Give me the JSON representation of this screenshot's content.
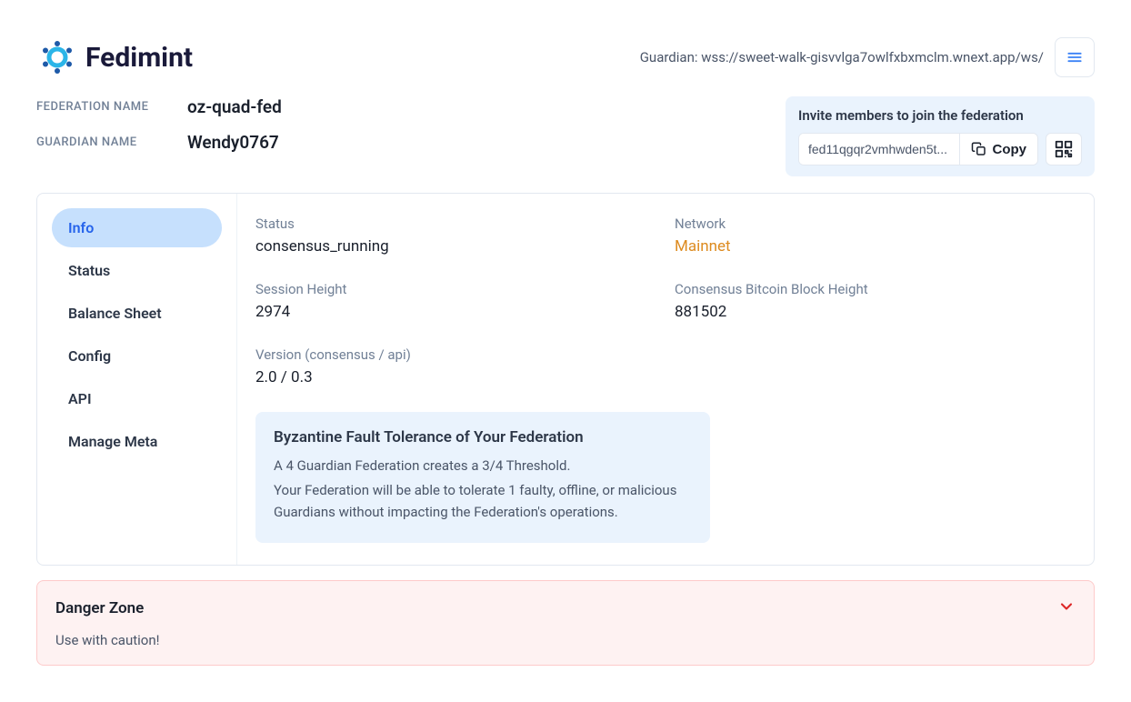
{
  "brand": "Fedimint",
  "header": {
    "guardian_url": "Guardian: wss://sweet-walk-gisvvlga7owlfxbxmclm.wnext.app/ws/"
  },
  "meta": {
    "fed_label": "FEDERATION NAME",
    "fed_value": "oz-quad-fed",
    "guardian_label": "GUARDIAN NAME",
    "guardian_value": "Wendy0767"
  },
  "invite": {
    "title": "Invite members to join the federation",
    "code": "fed11qgqr2vmhwden5t...",
    "copy_label": "Copy"
  },
  "sidebar": {
    "items": [
      "Info",
      "Status",
      "Balance Sheet",
      "Config",
      "API",
      "Manage Meta"
    ],
    "active_index": 0
  },
  "info": {
    "status_label": "Status",
    "status_value": "consensus_running",
    "network_label": "Network",
    "network_value": "Mainnet",
    "session_label": "Session Height",
    "session_value": "2974",
    "block_label": "Consensus Bitcoin Block Height",
    "block_value": "881502",
    "version_label": "Version (consensus / api)",
    "version_value": "2.0 / 0.3"
  },
  "bft": {
    "title": "Byzantine Fault Tolerance of Your Federation",
    "line1": "A 4 Guardian Federation creates a 3/4 Threshold.",
    "line2": "Your Federation will be able to tolerate 1 faulty, offline, or malicious Guardians without impacting the Federation's operations."
  },
  "danger": {
    "title": "Danger Zone",
    "subtitle": "Use with caution!"
  }
}
